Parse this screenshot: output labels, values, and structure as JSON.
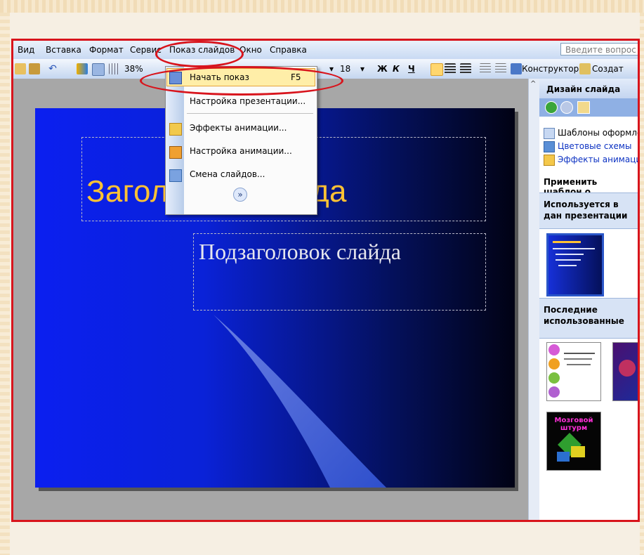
{
  "menu": {
    "items": [
      "Вид",
      "Вставка",
      "Формат",
      "Сервис",
      "Показ слайдов",
      "Окно",
      "Справка"
    ],
    "ask_placeholder": "Введите вопрос"
  },
  "toolbar": {
    "zoom": "38%",
    "font_size": "18",
    "bold": "Ж",
    "italic": "К",
    "underline": "Ч",
    "designer": "Конструктор",
    "create": "Создат"
  },
  "slideshow_menu": {
    "items": [
      {
        "label": "Начать показ",
        "shortcut": "F5",
        "icon": "slideshow-icon"
      },
      {
        "label": "Настройка презентации...",
        "shortcut": "",
        "icon": ""
      },
      {
        "label": "Эффекты анимации...",
        "shortcut": "",
        "icon": "animation-effects-icon"
      },
      {
        "label": "Настройка анимации...",
        "shortcut": "",
        "icon": "custom-animation-icon"
      },
      {
        "label": "Смена слайдов...",
        "shortcut": "",
        "icon": "slide-transition-icon"
      }
    ],
    "expand": "»"
  },
  "slide": {
    "title": "Заголовок слайда",
    "subtitle": "Подзаголовок слайда"
  },
  "task_pane": {
    "title": "Дизайн слайда",
    "links": [
      "Шаблоны оформлен",
      "Цветовые схемы",
      "Эффекты анимации"
    ],
    "apply_label": "Применить шаблон о",
    "section_used": "Используется в дан презентации",
    "section_recent": "Последние использованные",
    "thumb_labels": [
      "Мозговой штурм"
    ]
  },
  "colors": {
    "accent_red": "#d8141c",
    "slide_title": "#ffc234",
    "slide_bg": "#0b1ff0",
    "menu_highlight": "#ffeea8"
  }
}
